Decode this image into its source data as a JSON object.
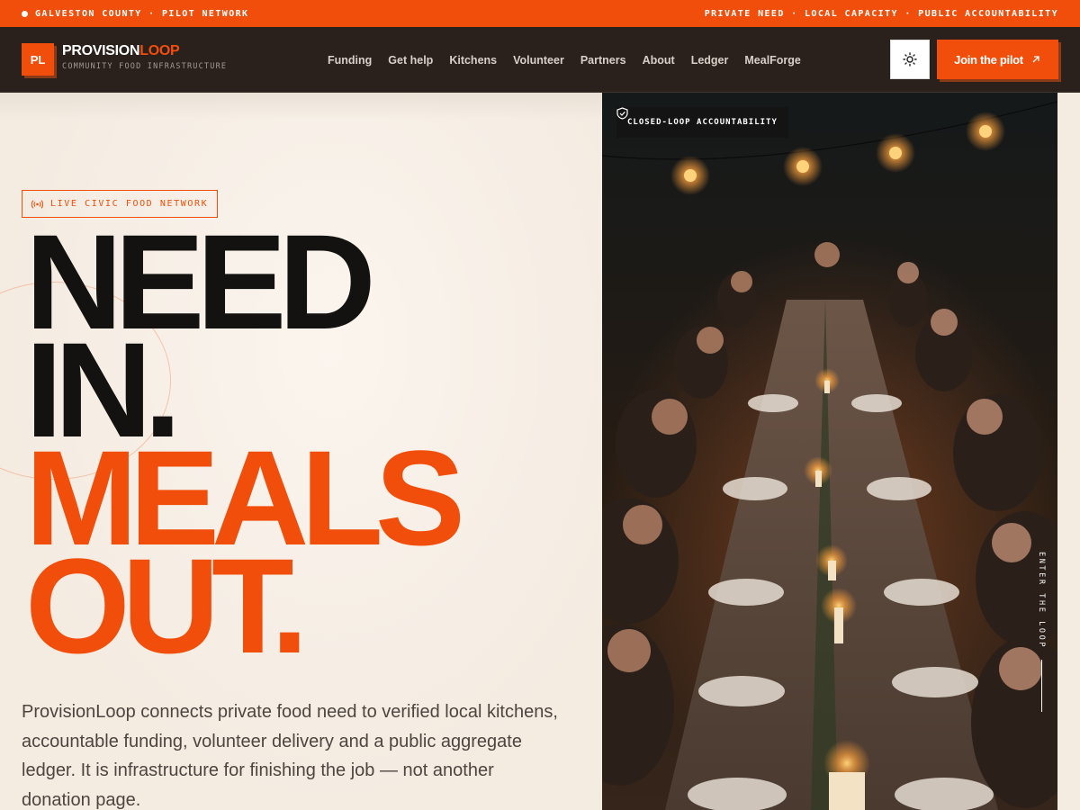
{
  "topbar": {
    "left": "GALVESTON COUNTY · PILOT NETWORK",
    "right": "PRIVATE NEED · LOCAL CAPACITY · PUBLIC ACCOUNTABILITY"
  },
  "brand": {
    "mark": "PL",
    "name_part1": "PROVISION",
    "name_part2": "LOOP",
    "tagline": "COMMUNITY FOOD INFRASTRUCTURE"
  },
  "nav": {
    "items": [
      "Funding",
      "Get help",
      "Kitchens",
      "Volunteer",
      "Partners",
      "About",
      "Ledger",
      "MealForge"
    ]
  },
  "header": {
    "theme_icon": "sun-icon",
    "join_label": "Join the pilot",
    "join_icon": "arrow-up-right-icon"
  },
  "hero": {
    "badge": "LIVE CIVIC FOOD NETWORK",
    "badge_icon": "broadcast-icon",
    "line1": "NEED",
    "line2": "IN.",
    "line3": "MEALS",
    "line4": "OUT.",
    "description": "ProvisionLoop connects private food need to verified local kitchens, accountable funding, volunteer delivery and a public aggregate ledger. It is infrastructure for finishing the job — not another donation page."
  },
  "photo": {
    "badge": "CLOSED-LOOP ACCOUNTABILITY",
    "badge_icon": "shield-check-icon",
    "side_label": "ENTER THE LOOP"
  },
  "colors": {
    "accent": "#f24e0b",
    "header_bg": "#2a211c",
    "page_bg": "#f5ede4",
    "ink": "#141210"
  }
}
